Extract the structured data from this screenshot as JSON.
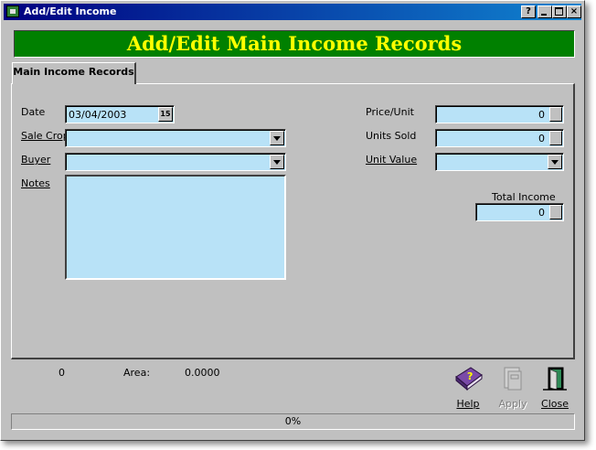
{
  "window": {
    "title": "Add/Edit  Income",
    "help_btn": "?",
    "close_btn": "×"
  },
  "banner": {
    "title": "Add/Edit Main Income Records"
  },
  "tabs": [
    {
      "label": "Main Income Records",
      "selected": true
    }
  ],
  "form": {
    "date": {
      "label": "Date",
      "value": "03/04/2003",
      "calendar_glyph": "15"
    },
    "sale_crop": {
      "label": "Sale Crop",
      "value": ""
    },
    "buyer": {
      "label": "Buyer",
      "value": ""
    },
    "notes": {
      "label": "Notes",
      "value": ""
    },
    "price_unit": {
      "label": "Price/Unit",
      "value": "0"
    },
    "units_sold": {
      "label": "Units Sold",
      "value": "0"
    },
    "unit_value": {
      "label": "Unit Value",
      "value": ""
    },
    "total_income": {
      "label": "Total Income",
      "value": "0"
    }
  },
  "status": {
    "count": "0",
    "area_label": "Area:",
    "area_value": "0.0000"
  },
  "actions": {
    "help": {
      "label": "Help",
      "icon": "help-book-icon"
    },
    "apply": {
      "label": "Apply",
      "icon": "apply-disabled-icon",
      "enabled": false
    },
    "close": {
      "label": "Close",
      "icon": "exit-door-icon"
    }
  },
  "progress": {
    "label": "0%",
    "fraction": 0
  },
  "colors": {
    "banner_bg": "#008000",
    "banner_text": "#ffff00",
    "field_bg": "#b8e2f7",
    "titlebar": "#000080"
  }
}
